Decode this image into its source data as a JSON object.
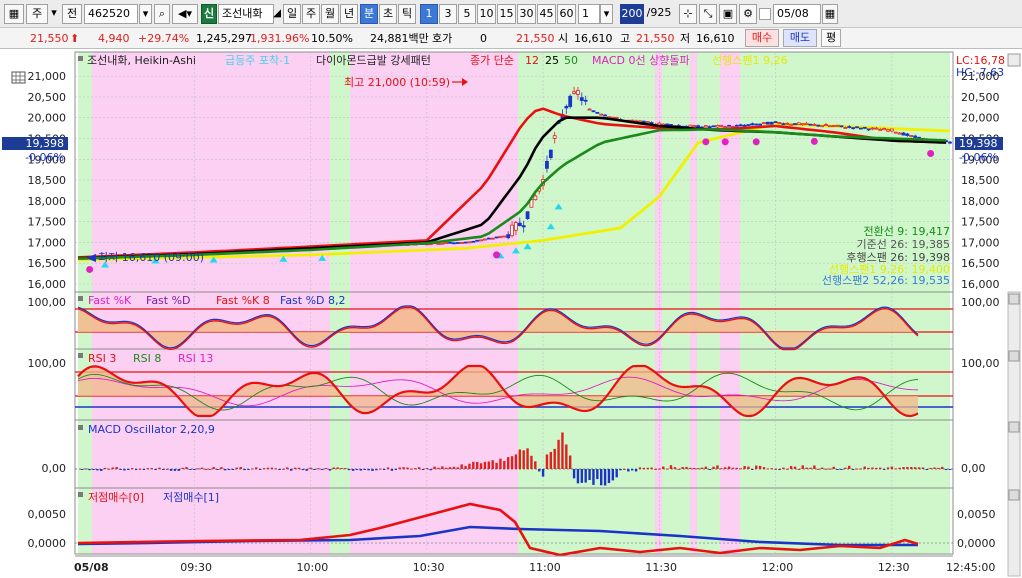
{
  "toolbar": {
    "mode_label": "주",
    "code_label": "전",
    "stock_code": "462520",
    "market_badge": "신",
    "stock_name": "조선내화",
    "period_buttons": [
      "일",
      "주",
      "월",
      "년",
      "분",
      "초",
      "틱"
    ],
    "selected_period": "분",
    "interval_buttons": [
      "1",
      "3",
      "5",
      "10",
      "15",
      "30",
      "45",
      "60"
    ],
    "selected_interval": "1",
    "interval_value": "1",
    "count_value": "200",
    "count_total": "/925",
    "date_value": "05/08"
  },
  "quote": {
    "price": "21,550",
    "change": "4,940",
    "change_pct": "+29.74%",
    "volume": "1,245,297",
    "volume_ratio": "1,931.96%",
    "turnover_pct": "10.50%",
    "amount": "24,881백만",
    "hoga_label": "호가",
    "hoga_value": "0",
    "current_price": "21,550",
    "open_label": "시",
    "open_value": "16,610",
    "high_label": "고",
    "high_value": "21,550",
    "low_label": "저",
    "low_value": "16,610",
    "buy_label": "매수",
    "sell_label": "매도",
    "eval_label": "평"
  },
  "legend": {
    "main": [
      "조선내화, Heikin-Ashi",
      "급등주 포착-1",
      "다이아몬드급발 강세패턴",
      "종가 단순",
      "12",
      "25",
      "50",
      "MACD 0선 상향돌파",
      "선행스팬1 9,26"
    ],
    "ichimoku": [
      "전환선 9: 19,417",
      "기준선 26: 19,385",
      "후행스팬 26: 19,398",
      "선행스팬1 9,26: 19,400",
      "선행스팬2 52,26: 19,535"
    ],
    "stoch": [
      "Fast %K",
      "Fast %D",
      "Fast %K 8",
      "Fast %D 8,2"
    ],
    "rsi": [
      "RSI 3",
      "RSI 8",
      "RSI 13"
    ],
    "macd": "MACD Oscillator 2,20,9",
    "bottom": [
      "저점매수[0]",
      "저점매수[1]"
    ]
  },
  "annotations": {
    "high": "최고 21,000 (10:59)",
    "low": "최저 16,610 (09:00)"
  },
  "right_axis": {
    "lc": "LC:16,78",
    "hc": "HC:-7.63",
    "price_marker": "19,398",
    "pct_marker": "-0.06%",
    "price_ticks": [
      "21,000",
      "20,500",
      "20,000",
      "19,500",
      "19,000",
      "18,500",
      "18,000",
      "17,500",
      "17,000",
      "16,500",
      "16,000"
    ],
    "stoch_tick": "100,00",
    "rsi_tick": "100,00",
    "macd_tick": "0,00",
    "bottom_ticks": [
      "0,0050",
      "0,0000"
    ]
  },
  "left_axis": {
    "price_marker": "19,398",
    "pct_marker": "-0.06%",
    "stoch_tick": "100,00",
    "rsi_tick": "100,00",
    "macd_tick": "0,00",
    "bottom_ticks": [
      "0,0050",
      "0,0000"
    ]
  },
  "time_axis": [
    "05/08",
    "09:30",
    "10:00",
    "10:30",
    "11:00",
    "11:30",
    "12:00",
    "12:30",
    "12:45:00"
  ],
  "colors": {
    "up": "#e0201e",
    "down": "#1a34c8",
    "pink_bg": "#fbd0f3",
    "green_bg": "#d0f7cc",
    "ma12": "#e81010",
    "ma25": "#000000",
    "ma50": "#1b8a1b",
    "span1": "#f0f000"
  },
  "chart_data": [
    {
      "type": "line",
      "title": "조선내화, Heikin-Ashi",
      "x": [
        "09:00",
        "09:30",
        "10:00",
        "10:30",
        "10:45",
        "10:55",
        "10:59",
        "11:05",
        "11:15",
        "11:30",
        "11:45",
        "12:00",
        "12:15",
        "12:30",
        "12:45"
      ],
      "series": [
        {
          "name": "12",
          "values": [
            16640,
            16760,
            16900,
            17050,
            18400,
            19900,
            20250,
            20050,
            19850,
            19750,
            19720,
            19800,
            19650,
            19450,
            19400
          ]
        },
        {
          "name": "25",
          "values": [
            16620,
            16720,
            16860,
            17000,
            17450,
            18700,
            19450,
            20000,
            20000,
            19800,
            19700,
            19650,
            19550,
            19450,
            19400
          ]
        },
        {
          "name": "50",
          "values": [
            16610,
            16700,
            16820,
            16980,
            17150,
            17800,
            18350,
            18850,
            19400,
            19700,
            19720,
            19650,
            19550,
            19500,
            19450
          ]
        }
      ],
      "ylim": [
        16000,
        21200
      ]
    },
    {
      "type": "line",
      "title": "MACD Oscillator 2,20,9",
      "x": [
        "09:00",
        "09:30",
        "10:00",
        "10:30",
        "10:50",
        "10:56",
        "11:00",
        "11:15",
        "11:30",
        "12:00",
        "12:30",
        "12:45"
      ],
      "series": [
        {
          "name": "MACD Oscillator 2,20,9",
          "values": [
            0,
            0,
            0,
            0,
            2,
            5,
            -2,
            -1,
            0.4,
            0.4,
            0.3,
            0
          ]
        }
      ]
    }
  ]
}
